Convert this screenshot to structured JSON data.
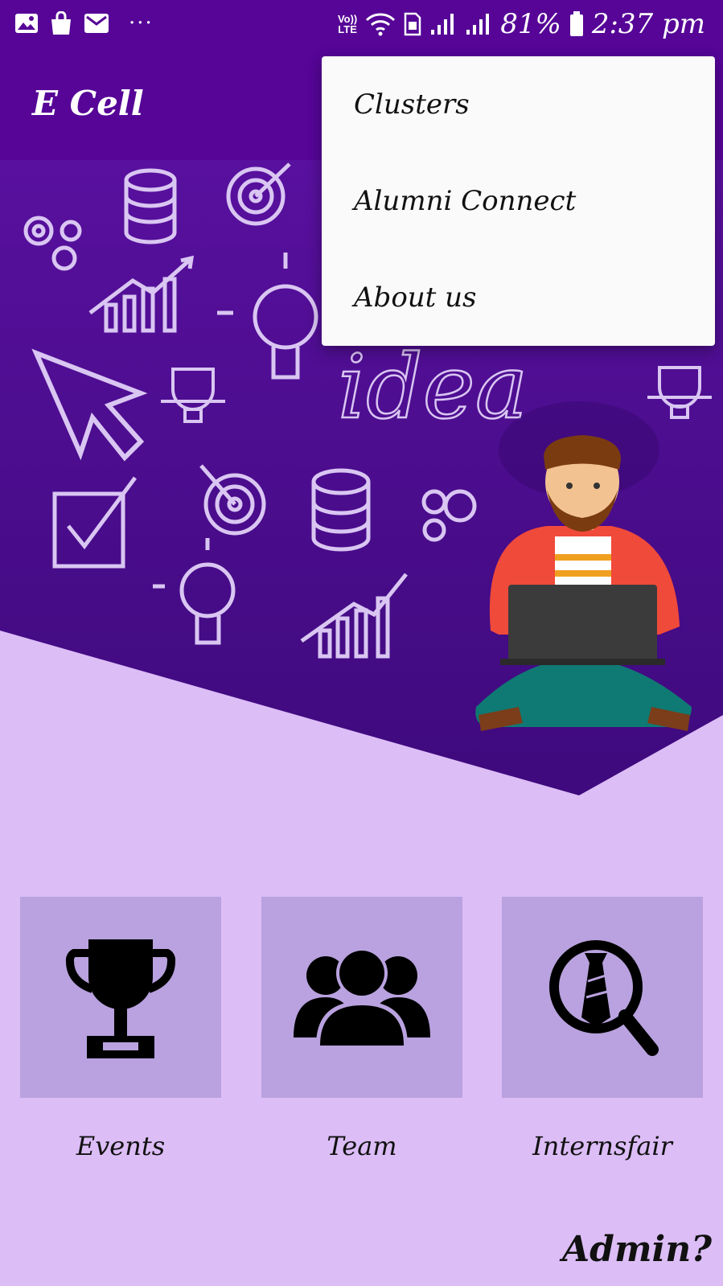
{
  "status_bar": {
    "left_icons": [
      "image-icon",
      "shopping-bag-icon",
      "mail-icon",
      "more-icon"
    ],
    "more_dots": "···",
    "network_top": "Vo))",
    "network_bottom": "LTE",
    "battery": "81%",
    "time": "2:37 pm"
  },
  "app_bar": {
    "title": "E Cell"
  },
  "overflow_menu": {
    "items": [
      {
        "label": "Clusters"
      },
      {
        "label": "Alumni Connect"
      },
      {
        "label": "About us"
      }
    ]
  },
  "hero": {
    "illustration_text": "idea",
    "icons": [
      "gears-icon",
      "coins-icon",
      "target-icon",
      "growth-chart-icon",
      "lightbulb-icon",
      "cursor-icon",
      "trophy-icon",
      "checkbox-icon",
      "person-with-laptop-illustration"
    ]
  },
  "tiles": [
    {
      "label": "Events",
      "icon": "trophy-icon"
    },
    {
      "label": "Team",
      "icon": "group-icon"
    },
    {
      "label": "Internsfair",
      "icon": "search-job-icon"
    }
  ],
  "admin_link": "Admin?",
  "colors": {
    "primary": "#560597",
    "hero_background": "#4b0a8f",
    "page_background": "#dcbdf6",
    "tile_background": "#b9a2df",
    "menu_background": "#fafafa"
  }
}
